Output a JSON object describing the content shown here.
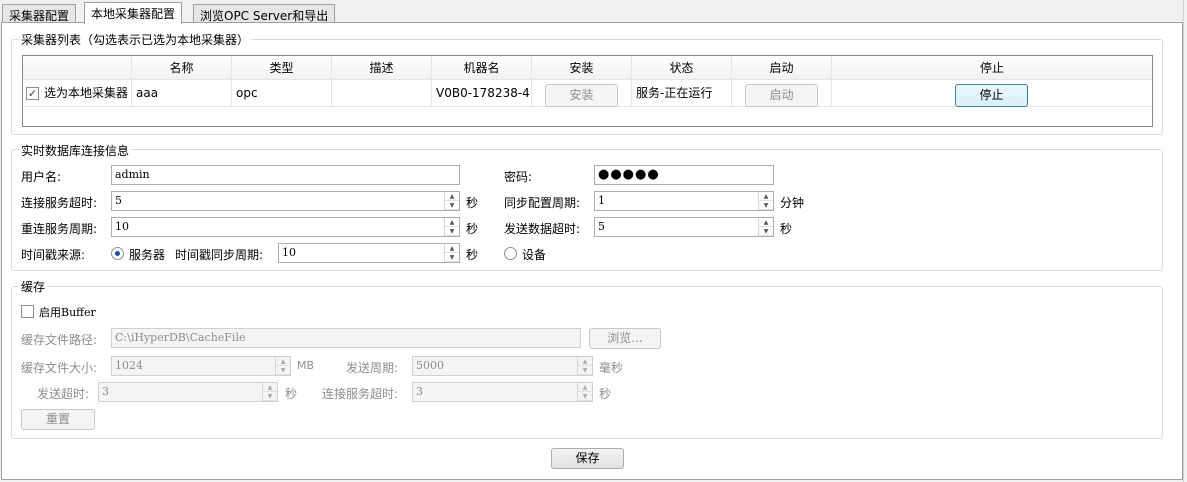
{
  "tabs": [
    {
      "label": "采集器配置"
    },
    {
      "label": "本地采集器配置"
    },
    {
      "label": "浏览OPC Server和导出"
    }
  ],
  "collector_list": {
    "title": "采集器列表（勾选表示已选为本地采集器）",
    "columns": [
      "名称",
      "类型",
      "描述",
      "机器名",
      "安装",
      "状态",
      "启动",
      "停止"
    ],
    "row": {
      "checkbox_label": "选为本地采集器",
      "checked": true,
      "name": "aaa",
      "type": "opc",
      "description": "",
      "machine": "V0B0-178238-4",
      "install_label": "安装",
      "status": "服务-正在运行",
      "start_label": "启动",
      "stop_label": "停止"
    }
  },
  "rtdb": {
    "title": "实时数据库连接信息",
    "username_label": "用户名:",
    "username": "admin",
    "password_label": "密码:",
    "password_mask": "●●●●●",
    "conn_timeout_label": "连接服务超时:",
    "conn_timeout": "5",
    "sec": "秒",
    "sync_period_label": "同步配置周期:",
    "sync_period": "1",
    "minute": "分钟",
    "reconnect_label": "重连服务周期:",
    "reconnect": "10",
    "send_timeout_label": "发送数据超时:",
    "send_timeout": "5",
    "ts_source_label": "时间戳来源:",
    "ts_server": "服务器",
    "ts_sync_label": "时间戳同步周期:",
    "ts_sync": "10",
    "ts_device": "设备"
  },
  "cache": {
    "title": "缓存",
    "enable_label": "启用Buffer",
    "path_label": "缓存文件路径:",
    "path": "C:\\iHyperDB\\CacheFile",
    "browse_label": "浏览...",
    "size_label": "缓存文件大小:",
    "size": "1024",
    "mb": "MB",
    "send_period_label": "发送周期:",
    "send_period": "5000",
    "ms": "毫秒",
    "send_timeout_label": "发送超时:",
    "send_timeout": "3",
    "sec": "秒",
    "conn_timeout_label": "连接服务超时:",
    "conn_timeout": "3",
    "reset_label": "重置"
  },
  "save_label": "保存"
}
